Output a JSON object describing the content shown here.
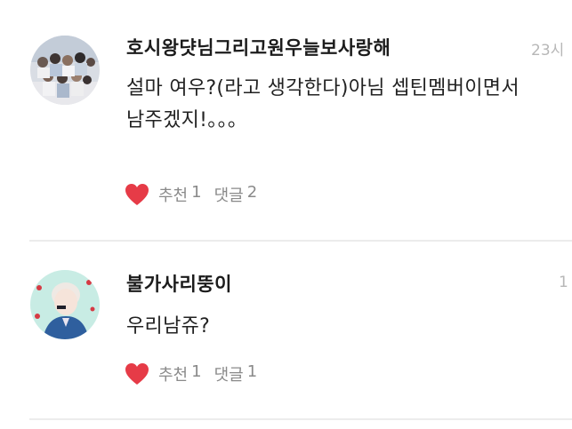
{
  "comments": [
    {
      "author": "호시왕댯님그리고원우늘보사랑해",
      "time": "23시",
      "body_lines": [
        "설마 여우?(라고 생각한다)아님 셉틴멤버이면서",
        "남주겠지!。。。"
      ],
      "like_label": "추천",
      "like_count": "1",
      "reply_label": "댓글",
      "reply_count": "2",
      "avatar_icon": "group-photo-avatar",
      "heart_color": "#e63b47"
    },
    {
      "author": "불가사리뚱이",
      "time": "1",
      "body_lines": [
        "우리남쥬?"
      ],
      "like_label": "추천",
      "like_count": "1",
      "reply_label": "댓글",
      "reply_count": "1",
      "avatar_icon": "profile-photo-avatar",
      "heart_color": "#e63b47"
    }
  ]
}
